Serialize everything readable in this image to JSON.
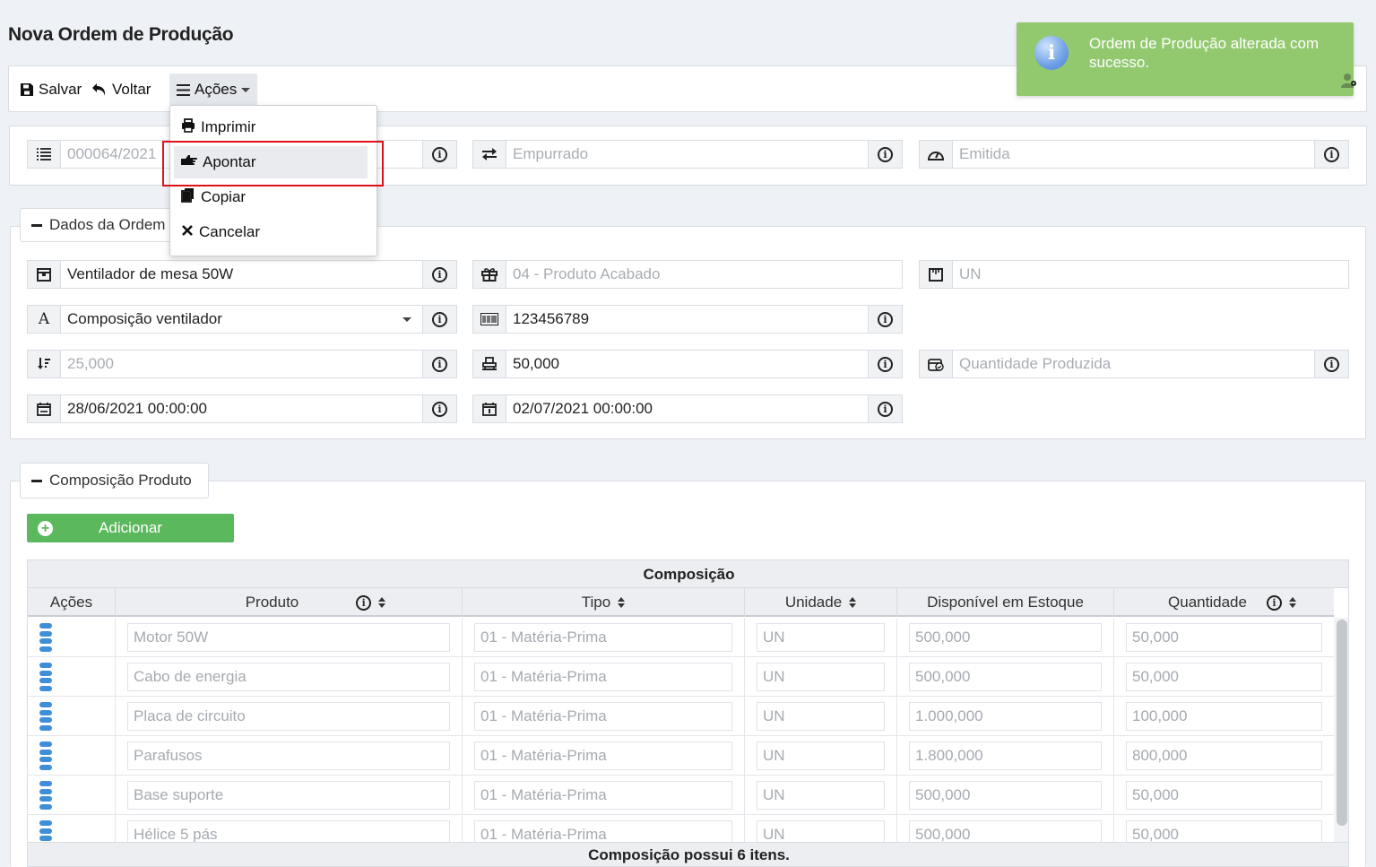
{
  "page": {
    "title": "Nova Ordem de Produção"
  },
  "toolbar": {
    "save_label": "Salvar",
    "back_label": "Voltar",
    "actions_label": "Ações"
  },
  "actions_menu": {
    "items": [
      "Imprimir",
      "Apontar",
      "Copiar",
      "Cancelar"
    ],
    "highlighted": "Apontar"
  },
  "toast": {
    "message": "Ordem de Produção alterada com sucesso.",
    "color": "#92c96f"
  },
  "header": {
    "number": "000064/2021",
    "type": "Empurrado",
    "status": "Emitida"
  },
  "dados": {
    "legend": "Dados da Ordem",
    "product": "Ventilador de mesa 50W",
    "product_type": "04 - Produto Acabado",
    "unit": "UN",
    "composition": "Composição ventilador",
    "barcode": "123456789",
    "min_qty": "25,000",
    "qty": "50,000",
    "produced_qty_placeholder": "Quantidade Produzida",
    "start_date": "28/06/2021 00:00:00",
    "end_date": "02/07/2021 00:00:00"
  },
  "composicao": {
    "legend": "Composição Produto",
    "add_label": "Adicionar",
    "grid_title": "Composição",
    "columns": [
      "Ações",
      "Produto",
      "Tipo",
      "Unidade",
      "Disponível em Estoque",
      "Quantidade"
    ],
    "rows": [
      [
        "Motor 50W",
        "01 - Matéria-Prima",
        "UN",
        "500,000",
        "50,000"
      ],
      [
        "Cabo de energia",
        "01 - Matéria-Prima",
        "UN",
        "500,000",
        "50,000"
      ],
      [
        "Placa de circuito",
        "01 - Matéria-Prima",
        "UN",
        "1.000,000",
        "100,000"
      ],
      [
        "Parafusos",
        "01 - Matéria-Prima",
        "UN",
        "1.800,000",
        "800,000"
      ],
      [
        "Base suporte",
        "01 - Matéria-Prima",
        "UN",
        "500,000",
        "50,000"
      ],
      [
        "Hélice 5 pás",
        "01 - Matéria-Prima",
        "UN",
        "500,000",
        "50,000"
      ]
    ],
    "footer": "Composição possui 6 itens."
  },
  "colors": {
    "accent_green": "#5cb85c",
    "grip_blue": "#3e8ed8",
    "highlight_red": "#e0101a"
  }
}
